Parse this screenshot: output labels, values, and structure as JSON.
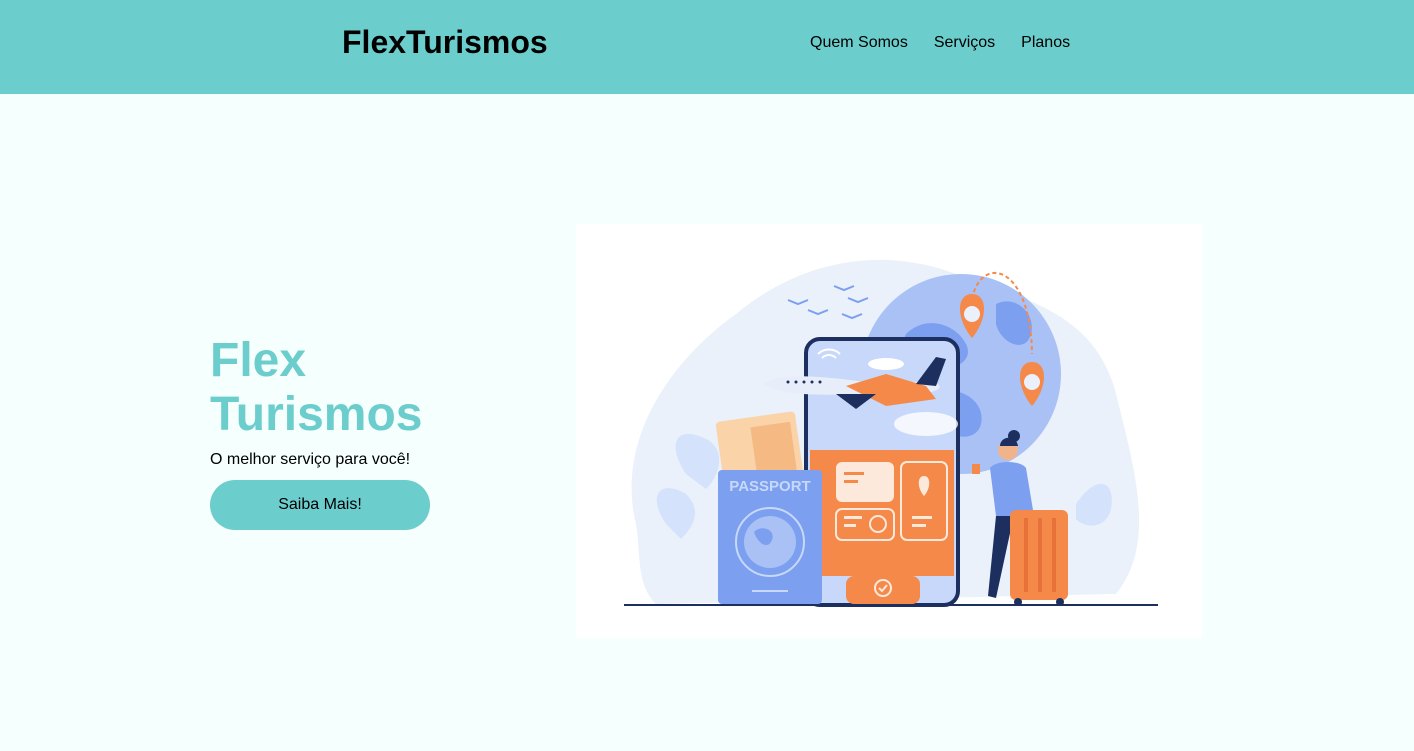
{
  "header": {
    "brand": "FlexTurismos",
    "nav": [
      {
        "label": "Quem Somos"
      },
      {
        "label": "Serviços"
      },
      {
        "label": "Planos"
      }
    ]
  },
  "hero": {
    "title_line1": "Flex",
    "title_line2": "Turismos",
    "subtitle": "O melhor serviço para você!",
    "cta_label": "Saiba Mais!"
  },
  "illustration": {
    "passport_label": "PASSPORT"
  },
  "colors": {
    "accent": "#6ccdcd",
    "background": "#f5fffe",
    "orange": "#f5894a",
    "blue": "#7c9ff0",
    "navy": "#1c2f5e"
  }
}
